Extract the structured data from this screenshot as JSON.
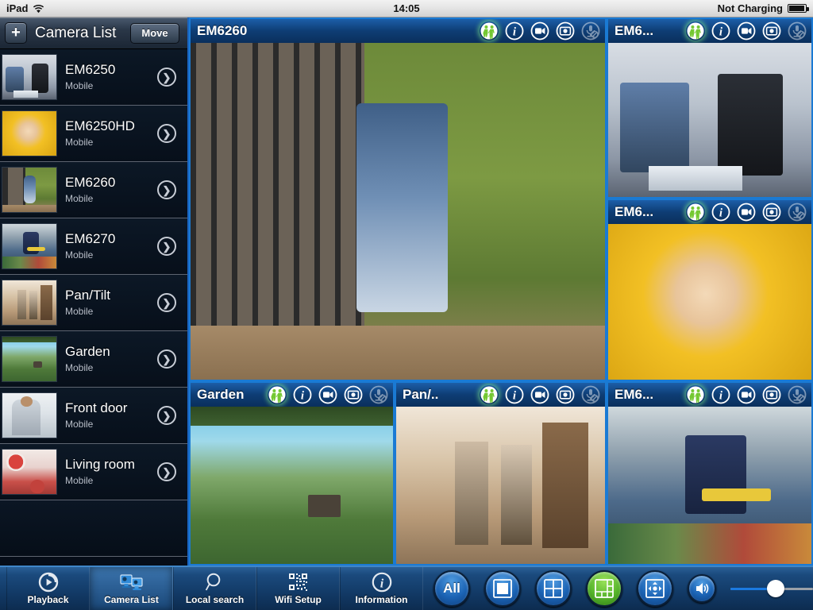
{
  "statusbar": {
    "device": "iPad",
    "wifi_icon": "wifi-icon",
    "time": "14:05",
    "battery_text": "Not Charging",
    "battery_icon": "battery-icon"
  },
  "sidebar": {
    "add_label": "+",
    "title": "Camera List",
    "move_label": "Move",
    "items": [
      {
        "name": "EM6250",
        "sub": "Mobile",
        "thumb": "office-meeting"
      },
      {
        "name": "EM6250HD",
        "sub": "Mobile",
        "thumb": "baby-yellow"
      },
      {
        "name": "EM6260",
        "sub": "Mobile",
        "thumb": "child-gate"
      },
      {
        "name": "EM6270",
        "sub": "Mobile",
        "thumb": "supermarket"
      },
      {
        "name": "Pan/Tilt",
        "sub": "Mobile",
        "thumb": "shoppers"
      },
      {
        "name": "Garden",
        "sub": "Mobile",
        "thumb": "landscape"
      },
      {
        "name": "Front door",
        "sub": "Mobile",
        "thumb": "man-white"
      },
      {
        "name": "Living room",
        "sub": "Mobile",
        "thumb": "red-interior"
      }
    ],
    "chevron_icon": "chevron-right-icon"
  },
  "panel_icons": [
    {
      "name": "motion-detect-icon",
      "state": "active"
    },
    {
      "name": "info-icon",
      "state": "normal"
    },
    {
      "name": "record-video-icon",
      "state": "normal"
    },
    {
      "name": "snapshot-icon",
      "state": "normal"
    },
    {
      "name": "microphone-off-icon",
      "state": "disabled"
    }
  ],
  "panes": [
    {
      "title": "EM6260",
      "scene": "child-gate",
      "role": "main"
    },
    {
      "title": "EM6...",
      "scene": "office-meeting",
      "role": "right-top"
    },
    {
      "title": "EM6...",
      "scene": "baby-yellow",
      "role": "right-mid"
    },
    {
      "title": "Garden",
      "scene": "landscape",
      "role": "bottom-left"
    },
    {
      "title": "Pan/..",
      "scene": "shoppers",
      "role": "bottom-mid"
    },
    {
      "title": "EM6...",
      "scene": "supermarket",
      "role": "bottom-right"
    }
  ],
  "toolbar": {
    "tabs": [
      {
        "label": "Playback",
        "icon": "playback-icon",
        "selected": false
      },
      {
        "label": "Camera List",
        "icon": "camera-list-icon",
        "selected": true
      },
      {
        "label": "Local search",
        "icon": "search-icon",
        "selected": false
      },
      {
        "label": "Wifi Setup",
        "icon": "qr-code-icon",
        "selected": false
      },
      {
        "label": "Information",
        "icon": "info-icon",
        "selected": false
      }
    ],
    "controls": [
      {
        "label": "All",
        "name": "all-cameras-button",
        "icon": "text",
        "active": false
      },
      {
        "label": "",
        "name": "layout-1-button",
        "icon": "layout-1-icon",
        "active": false
      },
      {
        "label": "",
        "name": "layout-4-button",
        "icon": "layout-4-icon",
        "active": false
      },
      {
        "label": "",
        "name": "layout-6-button",
        "icon": "layout-6-icon",
        "active": true
      },
      {
        "label": "",
        "name": "pan-tilt-button",
        "icon": "pan-tilt-icon",
        "active": false
      },
      {
        "label": "",
        "name": "speaker-button",
        "icon": "speaker-icon",
        "active": false
      }
    ],
    "volume": {
      "name": "volume-slider",
      "value": 55
    }
  },
  "colors": {
    "accent_blue": "#1a7ad4",
    "header_blue": "#0e3d74",
    "active_green": "#56b42b",
    "sidebar_bg": "#0a1525"
  }
}
